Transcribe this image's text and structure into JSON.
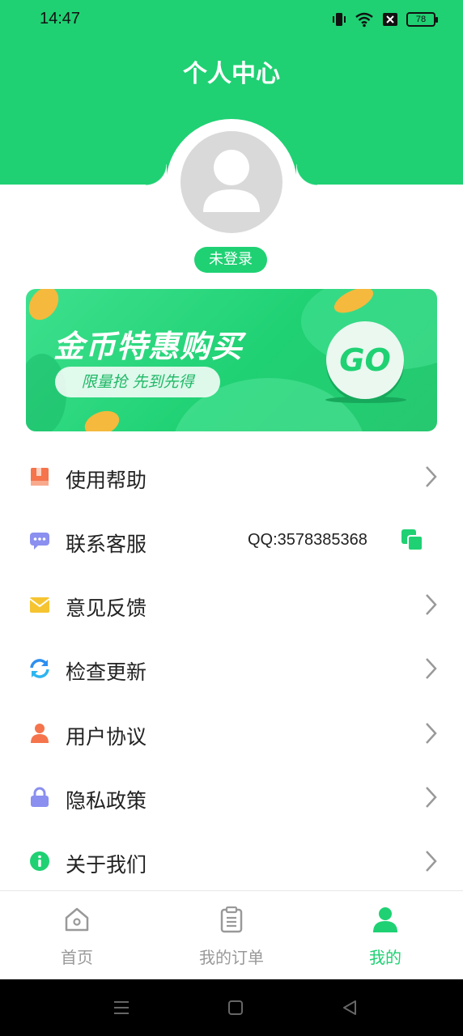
{
  "status_bar": {
    "time": "14:47",
    "battery": "78"
  },
  "header": {
    "title": "个人中心"
  },
  "profile": {
    "login_status": "未登录"
  },
  "banner": {
    "title": "金币特惠购买",
    "subtitle": "限量抢 先到先得",
    "go_label": "GO"
  },
  "menu": [
    {
      "label": "使用帮助",
      "icon": "book-icon",
      "color": "#f5744c"
    },
    {
      "label": "联系客服",
      "icon": "chat-icon",
      "color": "#8a8ff0",
      "extra": "QQ:3578385368"
    },
    {
      "label": "意见反馈",
      "icon": "mail-icon",
      "color": "#f6c431"
    },
    {
      "label": "检查更新",
      "icon": "refresh-icon",
      "color": "#2d8ff0"
    },
    {
      "label": "用户协议",
      "icon": "user-icon",
      "color": "#f5744c"
    },
    {
      "label": "隐私政策",
      "icon": "lock-icon",
      "color": "#8a8ff0"
    },
    {
      "label": "关于我们",
      "icon": "info-icon",
      "color": "#1fd173"
    }
  ],
  "tabbar": [
    {
      "label": "首页",
      "icon": "home-icon",
      "active": false
    },
    {
      "label": "我的订单",
      "icon": "orders-icon",
      "active": false
    },
    {
      "label": "我的",
      "icon": "profile-icon",
      "active": true
    }
  ],
  "colors": {
    "accent": "#1fd173",
    "inactive": "#999999"
  }
}
